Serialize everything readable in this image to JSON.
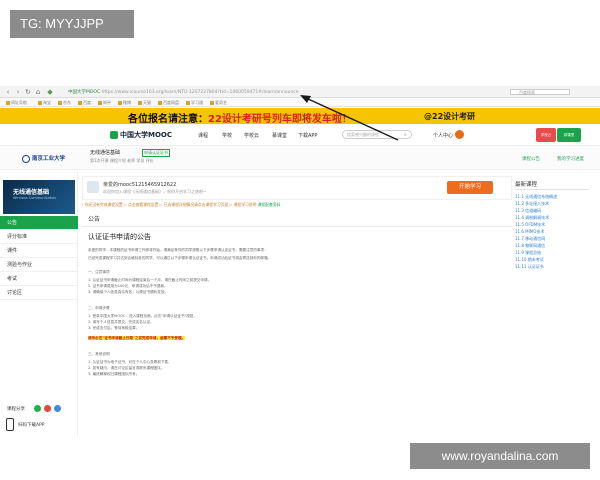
{
  "watermarks": {
    "top": "TG: MYYJJPP",
    "bottom": "www.royandalina.com"
  },
  "browser": {
    "url_domain": "中国大学MOOC",
    "url_rest": "https://www.icourse163.org/learn/NTU-1207227804?tid=1460059471#/learn/announce",
    "search_placeholder": "百度搜索",
    "bookmarks": [
      "网址导航",
      "淘宝",
      "京东",
      "百度",
      "知乎",
      "微博",
      "天猫",
      "百度网盘",
      "学习通",
      "爱奇艺"
    ]
  },
  "banner": {
    "lead": "各位报名请注意：",
    "highlight": "22设计考研号列车即将发车啦！",
    "side": "@22设计考研"
  },
  "header": {
    "logo": "中国大学MOOC",
    "nav": [
      "课程",
      "学校",
      "学校云",
      "慕课堂",
      "下载APP"
    ],
    "search_placeholder": "搜索感兴趣的课程",
    "user": "个人中心",
    "badge1": "学校云",
    "badge2": "慕课堂"
  },
  "course": {
    "university": "南京工业大学",
    "title": "无线通信基础",
    "cert": "申请认证证书",
    "meta": "第1次开课   课程介绍   老师 学员  评价",
    "right1": "课程公告",
    "right2": "我的学习进度"
  },
  "sidebar": {
    "cover_title": "无线通信基础",
    "cover_sub": "Wireless Communication",
    "items": [
      "公告",
      "评分标准",
      "课件",
      "测验与作业",
      "考试",
      "讨论区"
    ],
    "share_label": "课程分享",
    "phone_label": "扫码下载APP"
  },
  "main": {
    "enroll_name": "亲爱的mooc51215465912622",
    "enroll_sub": "欢迎你加入课程《无线通信基础》，祝你开启学习之旅吧~",
    "start_button": "开始学习",
    "tips": "! 你还没有完成课程设置   ▷ 点击查看课程设置   ▷ 已选课程详细情况请点击课程学习页面   ▷ 课程学习说明",
    "tips_green": "课程配套资料",
    "section_title": "公告",
    "doc_title": "认证证书申请的公告",
    "paragraphs": [
      "亲爱的同学：本课程的证书申请工作即将开始，请满足条件的同学按照以下步骤申请认证证书，需要注意的事项：",
      "已经完成课程学习并达到合格标准的同学，可以通过以下步骤申请认证证书，申请成功后证书将会寄送到你的邮箱。",
      "一、注意事项",
      "1. 认证证书申请截止时间为课程结束后一个月，请在截止时间之前提交申请。",
      "2. 证书申请费用为100元，申请成功后不予退款。",
      "3. 请确保个人信息真实有效，以便证书顺利发放。",
      "二、申请步骤",
      "1. 登录中国大学MOOC，进入课程页面，点击\"申请认证证书\"按钮。",
      "2. 填写个人信息并提交，完成实名认证。",
      "3. 完成支付后，等待审核结果。",
      "三、其他说明",
      "1. 认证证书为电子证书，可在个人中心查看和下载。",
      "2. 如有疑问，请在讨论区留言或联系课程团队。",
      "3. 最终解释权归课程团队所有。"
    ],
    "hl_line": "请务必在\"证书申请截止日期\"之前完成申请，逾期不予受理。"
  },
  "rail": {
    "title": "最新课程",
    "items": [
      "11.1 无线通信系统概述",
      "11.2 多址接入技术",
      "11.3 信道编码",
      "11.4 调制解调技术",
      "11.5 OFDM技术",
      "11.6 MIMO技术",
      "11.7 移动通信网",
      "11.8 物联网通信",
      "11.9 课程总结",
      "11.10 期末考试",
      "11.11 认证证书"
    ]
  },
  "colors": {
    "banner": "#f6c400",
    "primary_green": "#1aa34a",
    "start_orange": "#ef6c1e"
  }
}
